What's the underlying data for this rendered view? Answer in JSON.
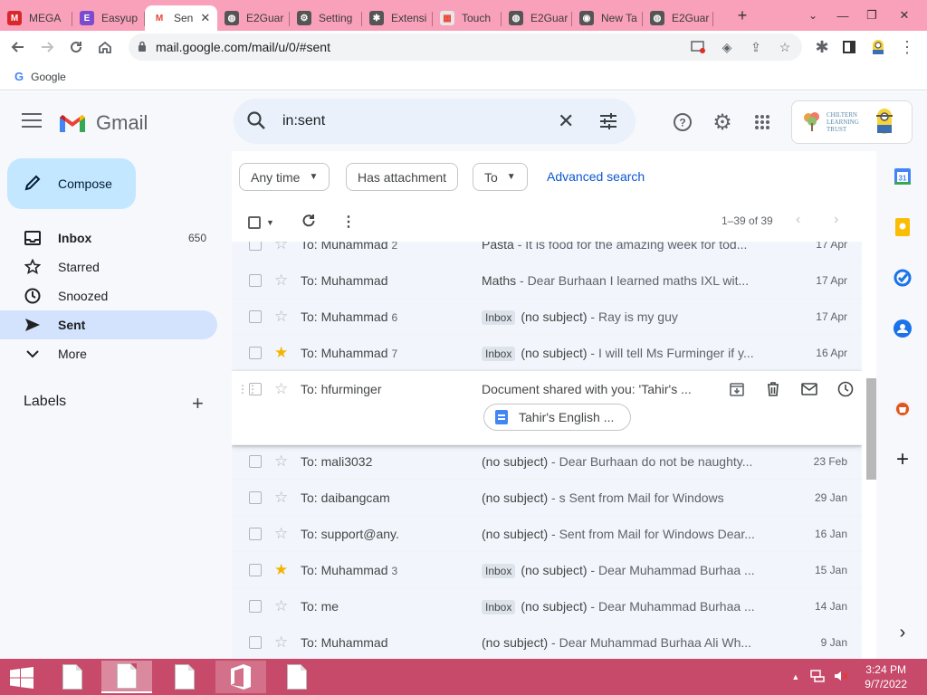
{
  "browser": {
    "tabs": [
      {
        "label": "MEGA",
        "fav_color": "#d9272e",
        "fav_glyph": "M"
      },
      {
        "label": "Easyup",
        "fav_color": "#7b4bd0",
        "fav_glyph": "E"
      },
      {
        "label": "Sen",
        "fav_color": "#ffffff",
        "fav_glyph": "M"
      },
      {
        "label": "E2Guar",
        "fav_color": "#555555",
        "fav_glyph": "◍"
      },
      {
        "label": "Setting",
        "fav_color": "#555555",
        "fav_glyph": "⚙"
      },
      {
        "label": "Extensi",
        "fav_color": "#555555",
        "fav_glyph": "✱"
      },
      {
        "label": "Touch",
        "fav_color": "#e7e7e7",
        "fav_glyph": "▦"
      },
      {
        "label": "E2Guar",
        "fav_color": "#555555",
        "fav_glyph": "◍"
      },
      {
        "label": "New Ta",
        "fav_color": "#555555",
        "fav_glyph": "◉"
      },
      {
        "label": "E2Guar",
        "fav_color": "#555555",
        "fav_glyph": "◍"
      }
    ],
    "active_tab_close": "✕",
    "new_tab": "+",
    "url": "mail.google.com/mail/u/0/#sent",
    "bookmark": "Google"
  },
  "gmail": {
    "brand": "Gmail",
    "search_query": "in:sent",
    "org_name": "CHILTERN LEARNING TRUST",
    "compose": "Compose",
    "nav": [
      {
        "label": "Inbox",
        "count": "650",
        "icon": "inbox-icon"
      },
      {
        "label": "Starred",
        "count": "",
        "icon": "star-icon"
      },
      {
        "label": "Snoozed",
        "count": "",
        "icon": "clock-icon"
      },
      {
        "label": "Sent",
        "count": "",
        "icon": "send-icon"
      },
      {
        "label": "More",
        "count": "",
        "icon": "chevron-down-icon"
      }
    ],
    "labels_heading": "Labels",
    "filters": {
      "time": "Any time",
      "attachment": "Has attachment",
      "to": "To",
      "advanced": "Advanced search"
    },
    "paging": "1–39 of 39",
    "emails": [
      {
        "to": "To: Muhammad",
        "count": "2",
        "starred": false,
        "badge": "",
        "subject": "Pasta",
        "snippet": " - It is food for the amazing week for tod...",
        "date": "17 Apr"
      },
      {
        "to": "To: Muhammad",
        "count": "",
        "starred": false,
        "badge": "",
        "subject": "Maths",
        "snippet": " - Dear Burhaan I learned maths IXL wit...",
        "date": "17 Apr"
      },
      {
        "to": "To: Muhammad",
        "count": "6",
        "starred": false,
        "badge": "Inbox",
        "subject": "(no subject)",
        "snippet": " - Ray is my guy",
        "date": "17 Apr"
      },
      {
        "to": "To: Muhammad",
        "count": "7",
        "starred": true,
        "badge": "Inbox",
        "subject": "(no subject)",
        "snippet": " - I will tell Ms Furminger if y...",
        "date": "16 Apr"
      },
      {
        "to": "To: hfurminger",
        "count": "",
        "starred": false,
        "badge": "",
        "subject": "Document shared with you: 'Tahir's ...",
        "snippet": "",
        "date": "",
        "attachment": "Tahir's English ..."
      },
      {
        "to": "To: mali3032",
        "count": "",
        "starred": false,
        "badge": "",
        "subject": "(no subject)",
        "snippet": " - Dear Burhaan do not be naughty...",
        "date": "23 Feb"
      },
      {
        "to": "To: daibangcam",
        "count": "",
        "starred": false,
        "badge": "",
        "subject": "(no subject)",
        "snippet": " - s Sent from Mail for Windows",
        "date": "29 Jan"
      },
      {
        "to": "To: support@any.",
        "count": "",
        "starred": false,
        "badge": "",
        "subject": "(no subject)",
        "snippet": " - Sent from Mail for Windows Dear...",
        "date": "16 Jan"
      },
      {
        "to": "To: Muhammad",
        "count": "3",
        "starred": true,
        "badge": "Inbox",
        "subject": "(no subject)",
        "snippet": " - Dear Muhammad Burhaa ...",
        "date": "15 Jan"
      },
      {
        "to": "To: me",
        "count": "",
        "starred": false,
        "badge": "Inbox",
        "subject": "(no subject)",
        "snippet": " - Dear Muhammad Burhaa ...",
        "date": "14 Jan"
      },
      {
        "to": "To: Muhammad",
        "count": "",
        "starred": false,
        "badge": "",
        "subject": "(no subject)",
        "snippet": " - Dear Muhammad Burhaa Ali Wh...",
        "date": "9 Jan"
      }
    ],
    "side_panel": [
      "calendar-icon",
      "keep-icon",
      "tasks-icon",
      "contacts-icon",
      "addon-icon",
      "add-icon"
    ],
    "calendar_day": "31"
  },
  "taskbar": {
    "time": "3:24 PM",
    "date": "9/7/2022"
  },
  "colors": {
    "tab_strip": "#f9a0ba",
    "taskbar": "#c74a6a",
    "nav_active": "#d3e3fd",
    "compose": "#c2e7ff",
    "star_on": "#f4b400"
  }
}
